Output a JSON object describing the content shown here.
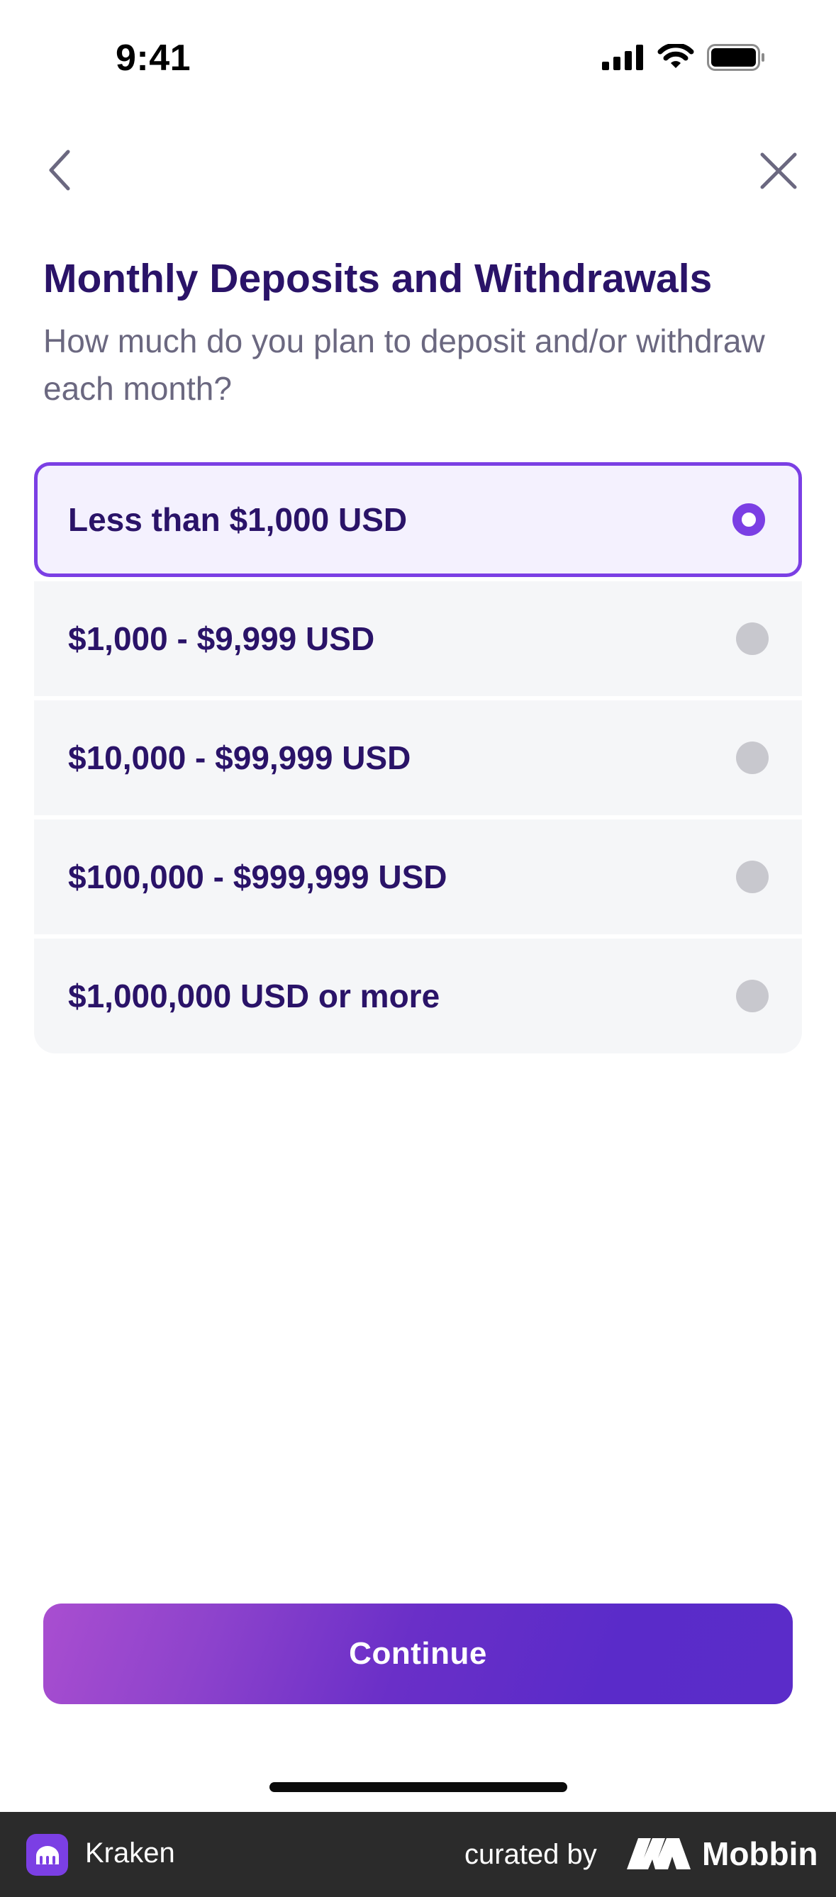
{
  "status_bar": {
    "time": "9:41",
    "icons": [
      "signal-icon",
      "wifi-icon",
      "battery-icon"
    ]
  },
  "nav": {
    "back_icon": "chevron-left-icon",
    "close_icon": "close-icon"
  },
  "header": {
    "title": "Monthly Deposits and Withdrawals",
    "subtitle": "How much do you plan to deposit and/or withdraw each month?"
  },
  "options": [
    {
      "label": "Less than $1,000 USD",
      "selected": true
    },
    {
      "label": "$1,000 - $9,999 USD",
      "selected": false
    },
    {
      "label": "$10,000 - $99,999 USD",
      "selected": false
    },
    {
      "label": "$100,000 - $999,999 USD",
      "selected": false
    },
    {
      "label": "$1,000,000 USD or more",
      "selected": false
    }
  ],
  "continue_label": "Continue",
  "footer": {
    "app_name": "Kraken",
    "curated_by": "curated by",
    "brand": "Mobbin"
  },
  "colors": {
    "accent": "#7b3fe4",
    "title": "#2a1368",
    "subtitle": "#6b6880",
    "option_bg": "#f5f6f8",
    "selected_bg": "#f4f1fe"
  }
}
